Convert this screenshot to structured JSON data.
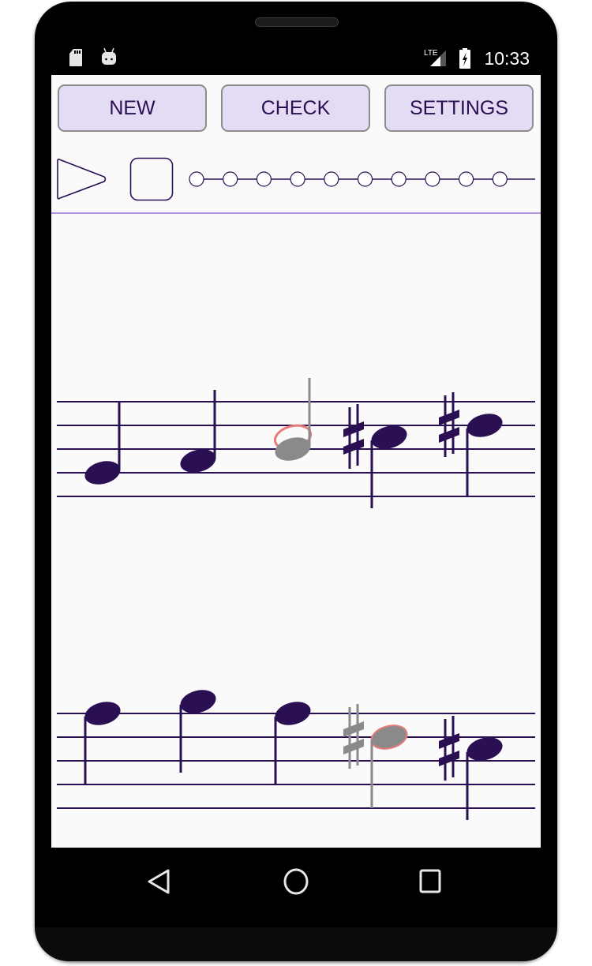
{
  "status_bar": {
    "time": "10:33",
    "network": "LTE",
    "icons": [
      "sd-card-icon",
      "android-debug-icon",
      "lte-signal-icon",
      "battery-charging-icon"
    ]
  },
  "toolbar": {
    "new_label": "NEW",
    "check_label": "CHECK",
    "settings_label": "SETTINGS"
  },
  "playback": {
    "play_icon": "play-icon",
    "stop_icon": "stop-icon",
    "progress_steps": 10,
    "progress_current": 0
  },
  "colors": {
    "ink": "#2a0f52",
    "button_bg": "#e4dcf4",
    "divider": "#b594e0",
    "wrong_note": "#8a8a8a",
    "correct_outline": "#e87a7a",
    "screen_bg": "#fafafa"
  },
  "staves": [
    {
      "name": "staff-1",
      "notes": [
        {
          "pitch": "G4",
          "accidental": "",
          "state": "normal"
        },
        {
          "pitch": "A4",
          "accidental": "",
          "state": "normal"
        },
        {
          "pitch": "B4",
          "accidental": "",
          "state": "wrong",
          "expected": "C5"
        },
        {
          "pitch": "C5",
          "accidental": "sharp",
          "state": "normal"
        },
        {
          "pitch": "D5",
          "accidental": "sharp",
          "state": "normal"
        }
      ]
    },
    {
      "name": "staff-2",
      "notes": [
        {
          "pitch": "F5",
          "accidental": "",
          "state": "normal"
        },
        {
          "pitch": "G5",
          "accidental": "",
          "state": "normal"
        },
        {
          "pitch": "F5",
          "accidental": "",
          "state": "normal"
        },
        {
          "pitch": "D5",
          "accidental": "sharp",
          "state": "wrong-highlighted"
        },
        {
          "pitch": "C5",
          "accidental": "sharp",
          "state": "normal"
        }
      ]
    }
  ],
  "nav_bar": {
    "back_icon": "back-icon",
    "home_icon": "home-icon",
    "recents_icon": "recents-icon"
  }
}
